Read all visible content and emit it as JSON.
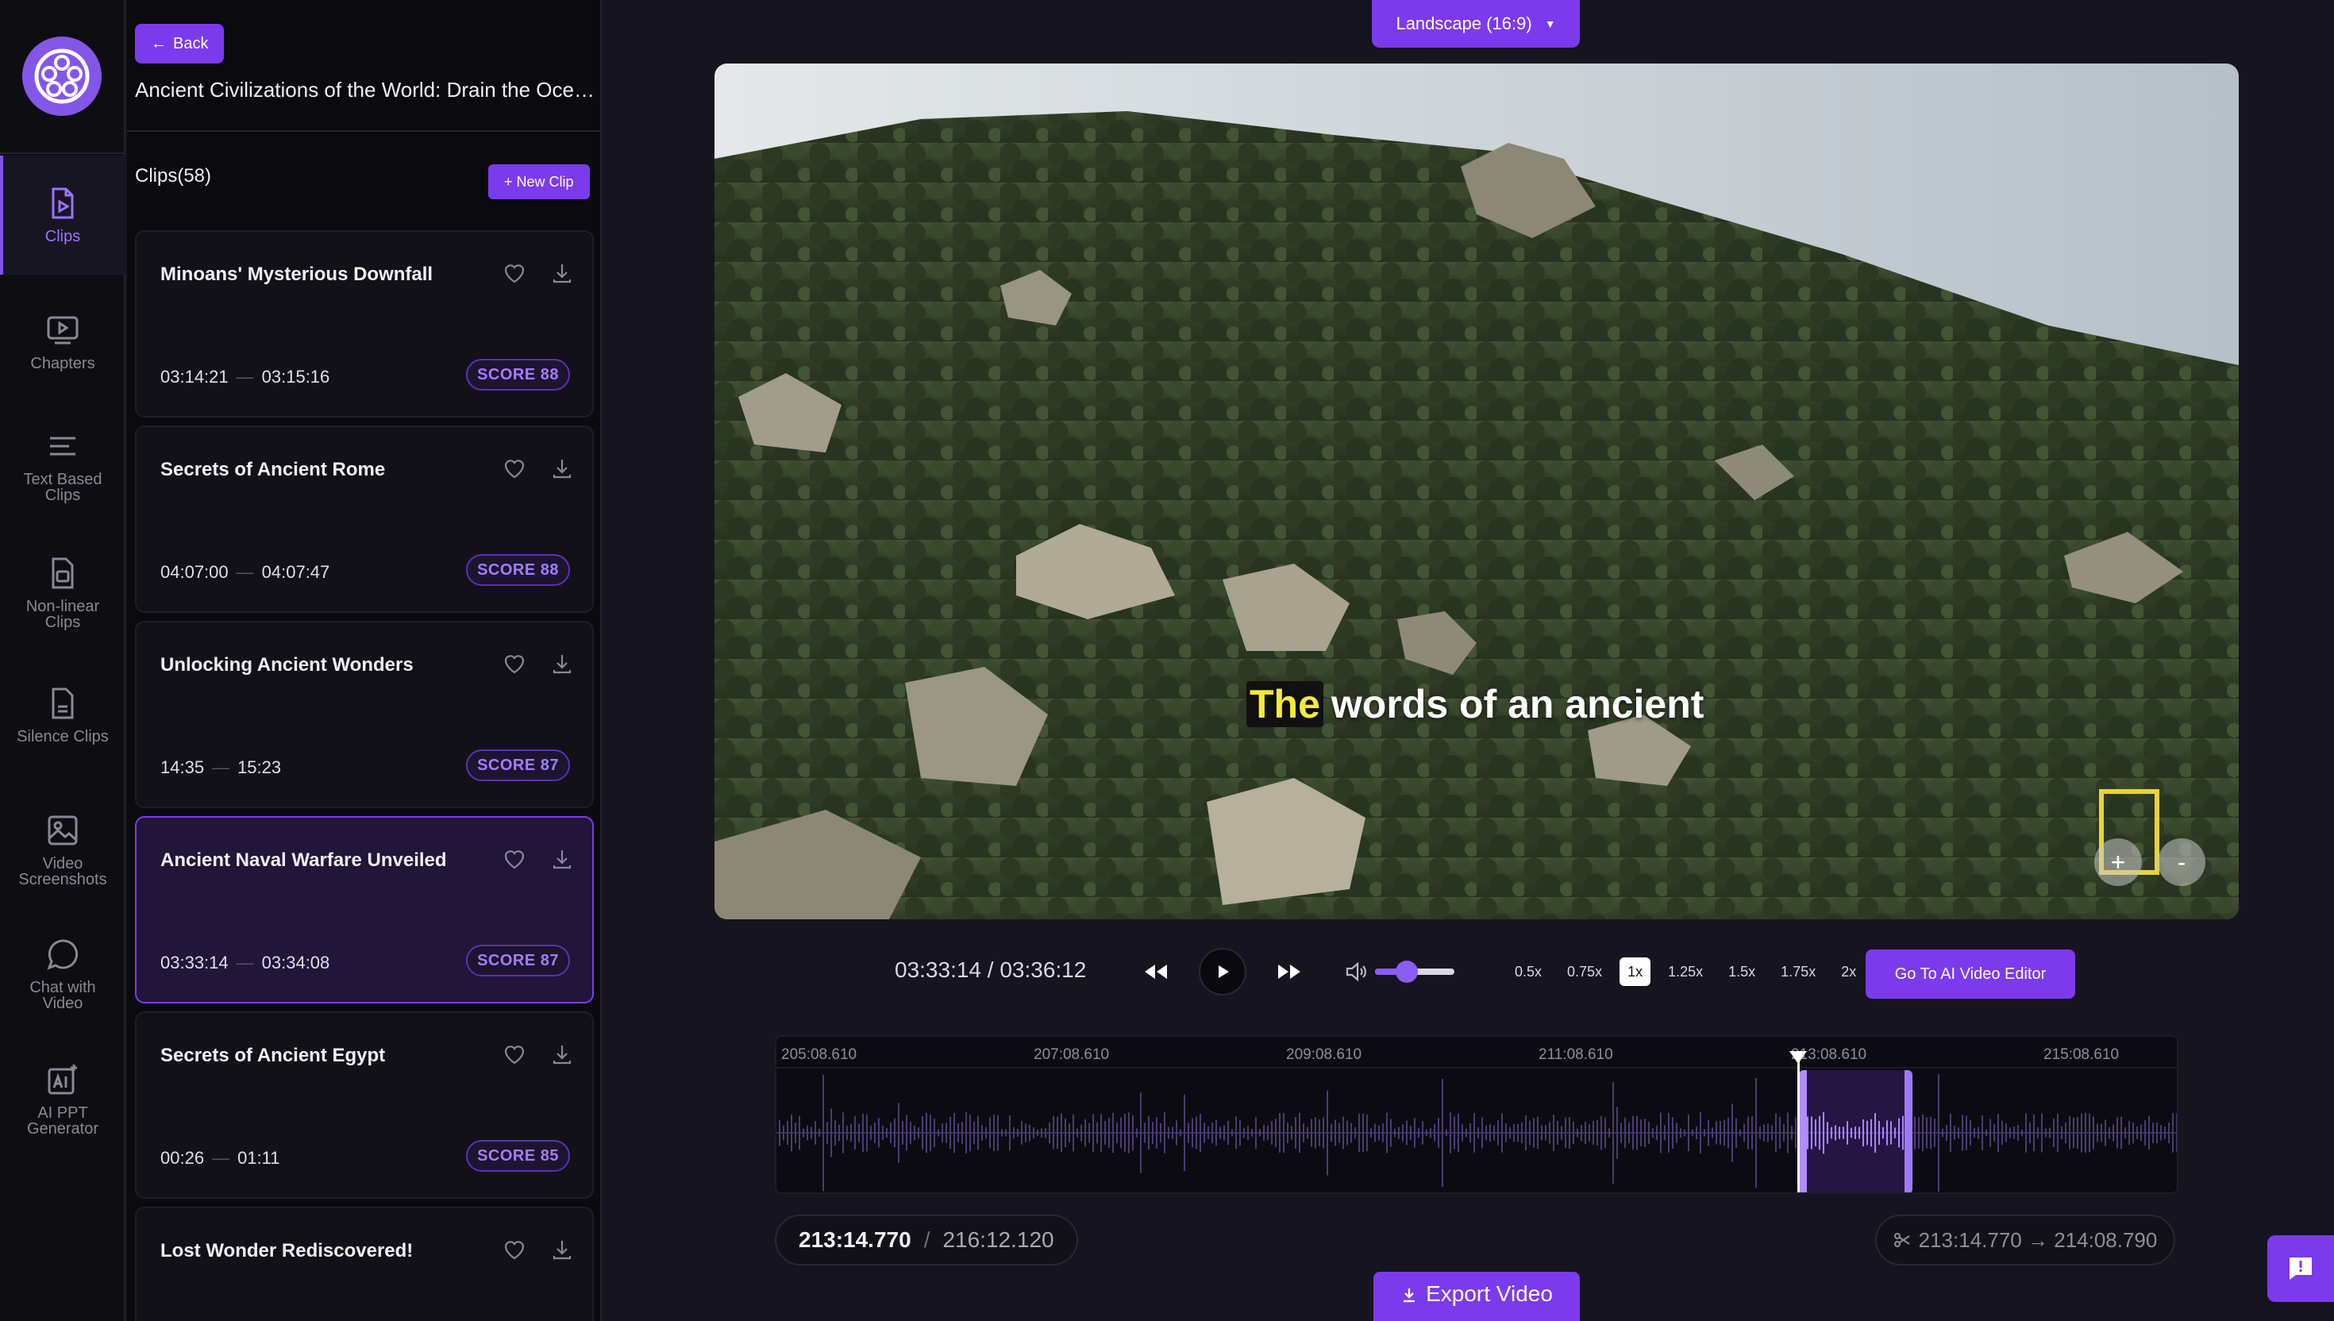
{
  "sidebar": {
    "items": [
      {
        "label": "Clips",
        "icon": "clips-icon"
      },
      {
        "label": "Chapters",
        "icon": "chapters-icon"
      },
      {
        "label": "Text Based Clips",
        "icon": "text-lines-icon"
      },
      {
        "label": "Non-linear Clips",
        "icon": "nonlinear-icon"
      },
      {
        "label": "Silence Clips",
        "icon": "silence-icon"
      },
      {
        "label": "Video Screenshots",
        "icon": "image-icon"
      },
      {
        "label": "Chat with Video",
        "icon": "chat-bubble-icon"
      },
      {
        "label": "AI PPT Generator",
        "icon": "ai-icon"
      }
    ]
  },
  "panel": {
    "back_label": "Back",
    "video_title": "Ancient Civilizations of the World: Drain the Oceans",
    "clips_header": "Clips(58)",
    "new_clip_label": "+ New Clip",
    "clips": [
      {
        "title": "Minoans' Mysterious Downfall",
        "start": "03:14:21",
        "end": "03:15:16",
        "score": "SCORE 88"
      },
      {
        "title": "Secrets of Ancient Rome",
        "start": "04:07:00",
        "end": "04:07:47",
        "score": "SCORE 88"
      },
      {
        "title": "Unlocking Ancient Wonders",
        "start": "14:35",
        "end": "15:23",
        "score": "SCORE 87"
      },
      {
        "title": "Ancient Naval Warfare Unveiled",
        "start": "03:33:14",
        "end": "03:34:08",
        "score": "SCORE 87"
      },
      {
        "title": "Secrets of Ancient Egypt",
        "start": "00:26",
        "end": "01:11",
        "score": "SCORE 85"
      },
      {
        "title": "Lost Wonder Rediscovered!",
        "start": "",
        "end": "",
        "score": ""
      }
    ]
  },
  "player": {
    "aspect_label": "Landscape (16:9)",
    "caption_highlight": "The",
    "caption_rest": "words of an ancient",
    "zoom_in_label": "+",
    "zoom_out_label": "-",
    "time_readout": "03:33:14 / 03:36:12",
    "volume_level": 0.4,
    "speeds": [
      "0.5x",
      "0.75x",
      "1x",
      "1.25x",
      "1.5x",
      "1.75x",
      "2x"
    ],
    "active_speed": "1x",
    "ai_editor_label": "Go To AI Video Editor"
  },
  "timeline": {
    "ticks": [
      "205:08.610",
      "207:08.610",
      "209:08.610",
      "211:08.610",
      "213:08.610",
      "215:08.610"
    ],
    "position": "213:14.770",
    "duration": "216:12.120",
    "range": "213:14.770 → 214:08.790",
    "selection_start_s": 12794.77,
    "selection_end_s": 12848.79,
    "view_start_s": 12308.61
  },
  "export_label": "Export Video",
  "colors": {
    "accent": "#7c3aed",
    "caption_highlight": "#f5ea3c",
    "focus_box": "#e8d33a"
  }
}
